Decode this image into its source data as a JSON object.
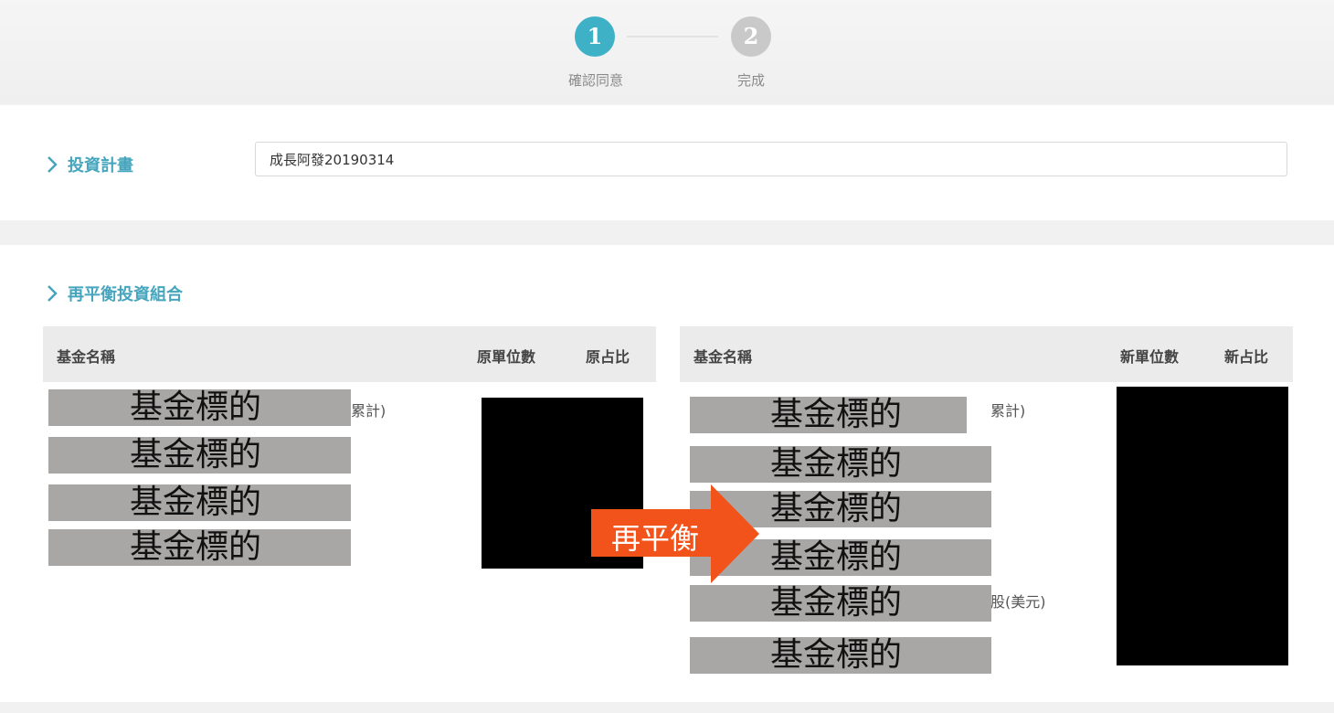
{
  "steps": [
    {
      "number": "1",
      "label": "確認同意",
      "active": true,
      "color": "#3fb1c6"
    },
    {
      "number": "2",
      "label": "完成",
      "active": false,
      "color": "#c9c9c9"
    }
  ],
  "plan": {
    "title": "投資計畫",
    "value": "成長阿發20190314"
  },
  "rebalance": {
    "title": "再平衡投資組合",
    "original": {
      "headers": {
        "name": "基金名稱",
        "units": "原單位數",
        "ratio": "原占比"
      },
      "funds": [
        "基金標的",
        "基金標的",
        "基金標的",
        "基金標的"
      ],
      "partial_texts": [
        "累計)"
      ]
    },
    "new": {
      "headers": {
        "name": "基金名稱",
        "units": "新單位數",
        "ratio": "新占比"
      },
      "funds": [
        "基金標的",
        "基金標的",
        "基金標的",
        "基金標的",
        "基金標的",
        "基金標的"
      ],
      "partial_texts": [
        "累計)",
        "股(美元)"
      ]
    },
    "arrow_label": "再平衡",
    "arrow_color": "#f2531b"
  }
}
